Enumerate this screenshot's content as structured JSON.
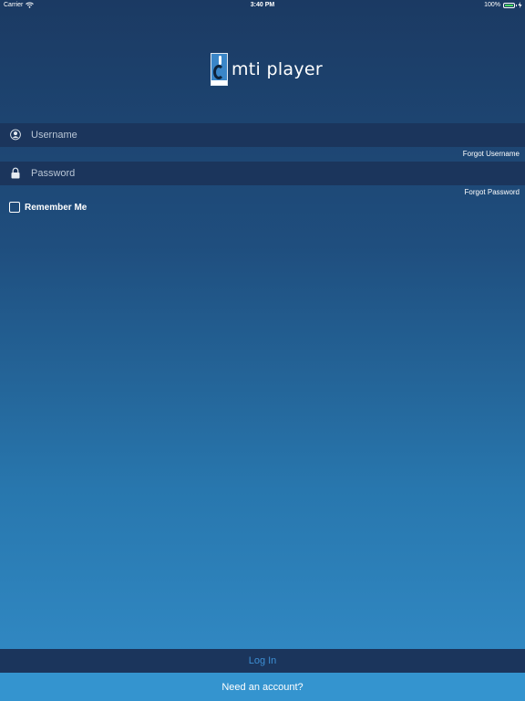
{
  "status_bar": {
    "carrier": "Carrier",
    "time": "3:40 PM",
    "battery": "100%",
    "icons": [
      "wifi-icon",
      "battery-icon",
      "charging-icon"
    ]
  },
  "app": {
    "title": "mti player",
    "logo_icon": "mti-logo-icon"
  },
  "login_form": {
    "username_placeholder": "Username",
    "password_placeholder": "Password",
    "username_icon": "user-icon",
    "password_icon": "lock-icon",
    "forgot_username": "Forgot Username",
    "forgot_password": "Forgot Password",
    "remember_me": "Remember Me",
    "remember_checked": false
  },
  "footer": {
    "login_label": "Log In",
    "account_label": "Need an account?"
  },
  "colors": {
    "gradient_top": "#1b3a63",
    "gradient_bottom": "#338dc8",
    "field_bg": "#1b355c",
    "login_text": "#3d8fd4",
    "account_bar": "#3494cf"
  }
}
